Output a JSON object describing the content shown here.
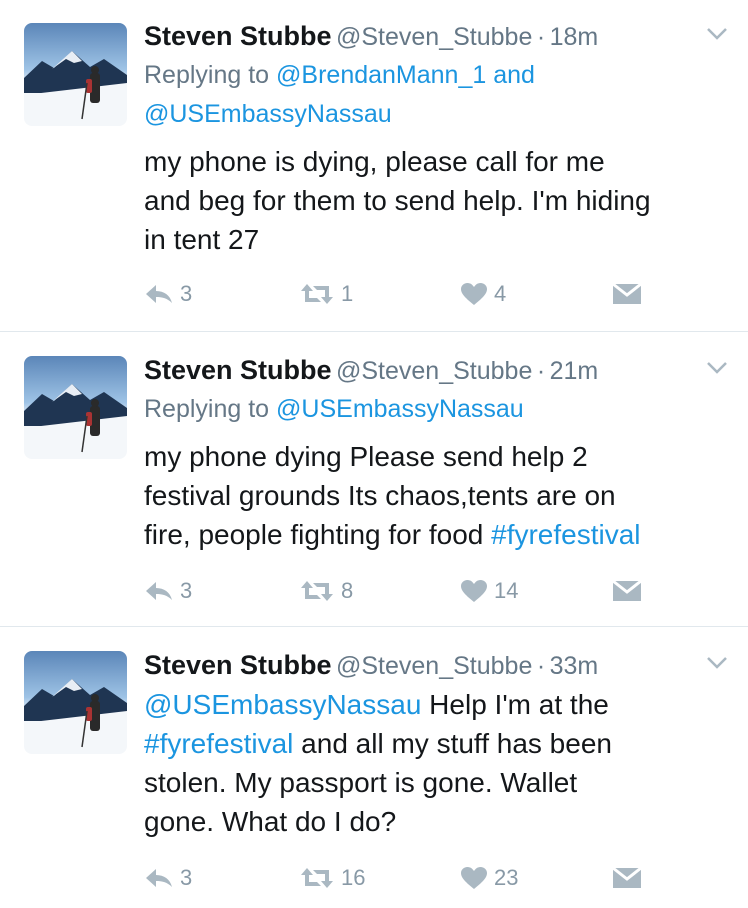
{
  "tweets": [
    {
      "name": "Steven Stubbe",
      "handle": "@Steven_Stubbe",
      "separator": "·",
      "time": "18m",
      "reply_prefix": "Replying to",
      "reply_mentions_line1": "@BrendanMann_1 and",
      "reply_mentions_line2": "@USEmbassyNassau",
      "text_lines": [
        "my phone is dying, please call for me",
        "and beg for them to send help. I'm hiding",
        "in tent 27"
      ],
      "counts": {
        "replies": "3",
        "retweets": "1",
        "likes": "4"
      }
    },
    {
      "name": "Steven Stubbe",
      "handle": "@Steven_Stubbe",
      "separator": "·",
      "time": "21m",
      "reply_prefix": "Replying to",
      "reply_mentions_line1": "@USEmbassyNassau",
      "text_lines": [
        "my phone dying Please send help 2",
        "festival grounds Its chaos,tents are on",
        "fire, people fighting for food "
      ],
      "hashtag": "#fyrefestival",
      "counts": {
        "replies": "3",
        "retweets": "8",
        "likes": "14"
      }
    },
    {
      "name": "Steven Stubbe",
      "handle": "@Steven_Stubbe",
      "separator": "·",
      "time": "33m",
      "mention": "@USEmbassyNassau",
      "text_line1_rest": " Help I'm at the",
      "hashtag": "#fyrefestival",
      "text_line2_rest": " and all my stuff has been",
      "text_lines_after": [
        "stolen. My passport is gone. Wallet",
        "gone. What do I do?"
      ],
      "counts": {
        "replies": "3",
        "retweets": "16",
        "likes": "23"
      }
    }
  ],
  "icons": {
    "reply": "reply-icon",
    "retweet": "retweet-icon",
    "like": "heart-icon",
    "dm": "direct-message-icon",
    "more": "chevron-down-icon"
  },
  "colors": {
    "link": "#1b95e0",
    "icon": "#aab8c2",
    "muted": "#657786"
  }
}
